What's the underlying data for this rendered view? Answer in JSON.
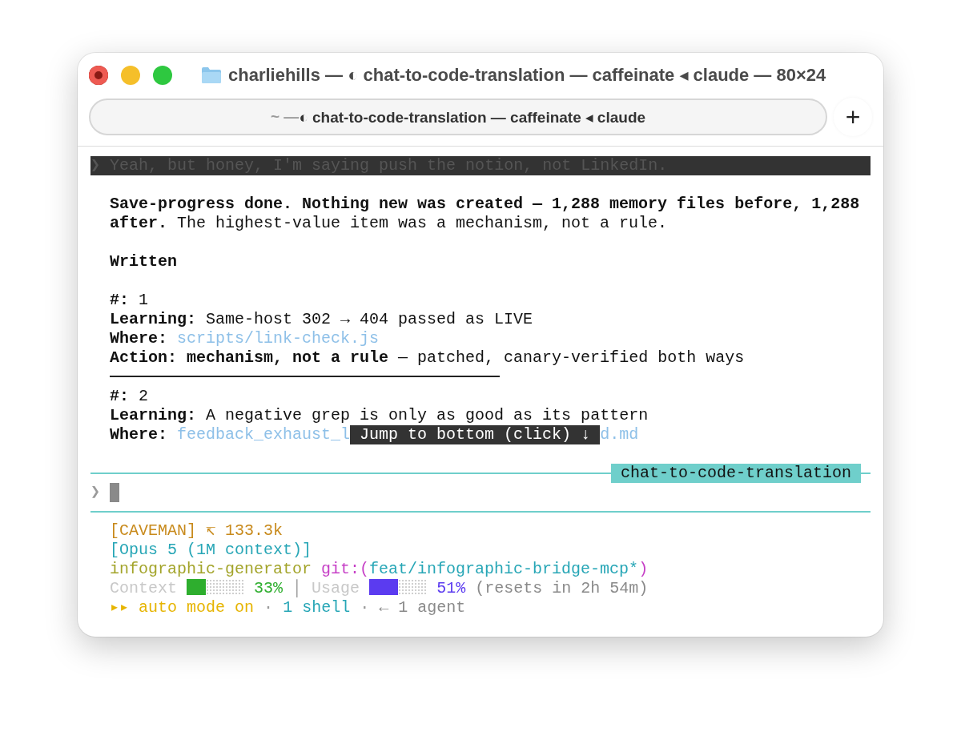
{
  "window": {
    "title": "charliehills — ◐ chat-to-code-translation — caffeinate ◂ claude — 80×24"
  },
  "tab": {
    "prefix": "~ —",
    "label": "◐ chat-to-code-translation — caffeinate ◂ claude"
  },
  "new_tab_button": "+",
  "terminal": {
    "previous_prompt": {
      "symbol": "❯",
      "text": "Yeah, but honey, I'm saying push the notion, not LinkedIn."
    },
    "summary": "**Save-progress done. Nothing new was created — 1,288 memory files before, 1,288 after.** The highest-value item was a mechanism, not a rule.",
    "heading": "Written",
    "entries": [
      {
        "number_label": "#:",
        "number": "1",
        "separator": true,
        "fields": [
          {
            "kind": "text",
            "label": "Learning:",
            "text": "Same-host 302 → 404 passed as LIVE"
          },
          {
            "kind": "path",
            "label": "Where:",
            "parts": [
              "scripts/link-check.js"
            ]
          },
          {
            "kind": "text",
            "label": "Action:",
            "text": "**mechanism, not a rule** — patched, canary-verified both ways"
          }
        ]
      },
      {
        "number_label": "#:",
        "number": "2",
        "separator": false,
        "fields": [
          {
            "kind": "text",
            "label": "Learning:",
            "text": "A negative grep is only as good as its pattern"
          },
          {
            "kind": "path",
            "label": "Where:",
            "parts": [
              "feedback_exhaust_l",
              "d.md"
            ]
          }
        ]
      }
    ],
    "jump_button": "Jump to bottom (click) ↓",
    "session_label": "chat-to-code-translation",
    "input_prompt": {
      "symbol": "❯"
    },
    "status_lines": [
      [
        {
          "text": "[CAVEMAN] ↸ 133.3k",
          "color": "#c88a1c"
        }
      ],
      [
        {
          "text": "[Opus 5 (1M context)]",
          "color": "#27a6b6"
        }
      ],
      [
        {
          "text": "infographic-generator",
          "color": "#a3a42a"
        },
        {
          "text": " git:(",
          "color": "#c63fc6"
        },
        {
          "text": "feat/infographic-bridge-mcp*",
          "color": "#27a6b6"
        },
        {
          "text": ")",
          "color": "#c63fc6"
        }
      ],
      [
        {
          "kind": "meter",
          "label": "Context",
          "level": 0.33,
          "color": "#2eae2e",
          "reading": "33%"
        },
        {
          "text": " │ ",
          "color": "#9a9a9a"
        },
        {
          "kind": "meter",
          "label": "Usage",
          "level": 0.51,
          "color": "#5b3bf0",
          "reading": "51%"
        },
        {
          "text": " (resets in 2h 54m)",
          "color": "#8a8a8a"
        }
      ],
      [
        {
          "text": "▸▸ auto mode on",
          "color": "#e6b400"
        },
        {
          "text": " · ",
          "color": "#9a9a9a"
        },
        {
          "text": "1 shell",
          "color": "#27a6b6"
        },
        {
          "text": " · ",
          "color": "#9a9a9a"
        },
        {
          "text": "← 1 agent",
          "color": "#8a8a8a"
        }
      ]
    ]
  }
}
